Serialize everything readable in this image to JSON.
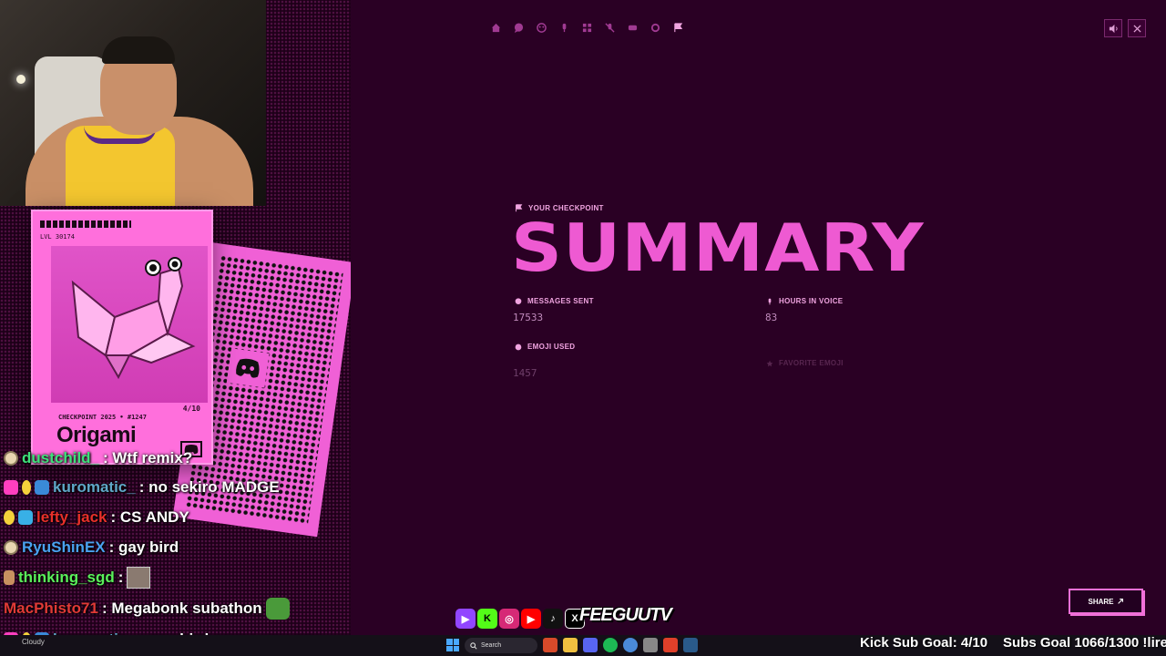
{
  "main": {
    "kicker": "YOUR CHECKPOINT",
    "title": "SUMMARY",
    "stats": {
      "messages_label": "MESSAGES SENT",
      "messages_value": "17533",
      "hours_label": "HOURS IN VOICE",
      "hours_value": "83",
      "emoji_label": "EMOJI USED",
      "emoji_value": "1457",
      "fav_label": "FAVORITE EMOJI"
    },
    "share_label": "SHARE",
    "nav_icons": [
      "home-icon",
      "chat-icon",
      "emoji-icon",
      "mic-icon",
      "apps-icon",
      "mute-icon",
      "gamepad-icon",
      "gear-icon",
      "flag-icon"
    ]
  },
  "card": {
    "level": "LVL 30174",
    "meta": "CHECKPOINT 2025 • #1247",
    "count": "4/10",
    "name": "Origami"
  },
  "chat": [
    {
      "user": "dustchild_",
      "message": ": Wtf remix?",
      "color": "#3ee07a"
    },
    {
      "user": "kuromatic_",
      "message": ": no sekiro MADGE",
      "color": "#5fa8c8"
    },
    {
      "user": "lefty_jack",
      "message": ": CS ANDY",
      "color": "#e8302a"
    },
    {
      "user": "RyuShinEX",
      "message": ": gay bird",
      "color": "#4aa2f0"
    },
    {
      "user": "thinking_sgd",
      "message": ":",
      "color": "#5af05a"
    },
    {
      "user": "MacPhisto71",
      "message": ": Megabonk subathon",
      "color": "#e03a36"
    },
    {
      "user": "kuromatic_",
      "message": ": gay bird cause you gay",
      "color": "#5fa8c8"
    }
  ],
  "overlay": {
    "brand": "FEEGUUTV",
    "kick_goal": "Kick Sub Goal: 4/10",
    "subs_goal": "Subs Goal 1066/1300 !lire"
  },
  "taskbar": {
    "weather": "Cloudy",
    "search_placeholder": "Search"
  },
  "colors": {
    "background": "#2a0024",
    "accent": "#ee5ad2",
    "card": "#ff6fdc"
  }
}
